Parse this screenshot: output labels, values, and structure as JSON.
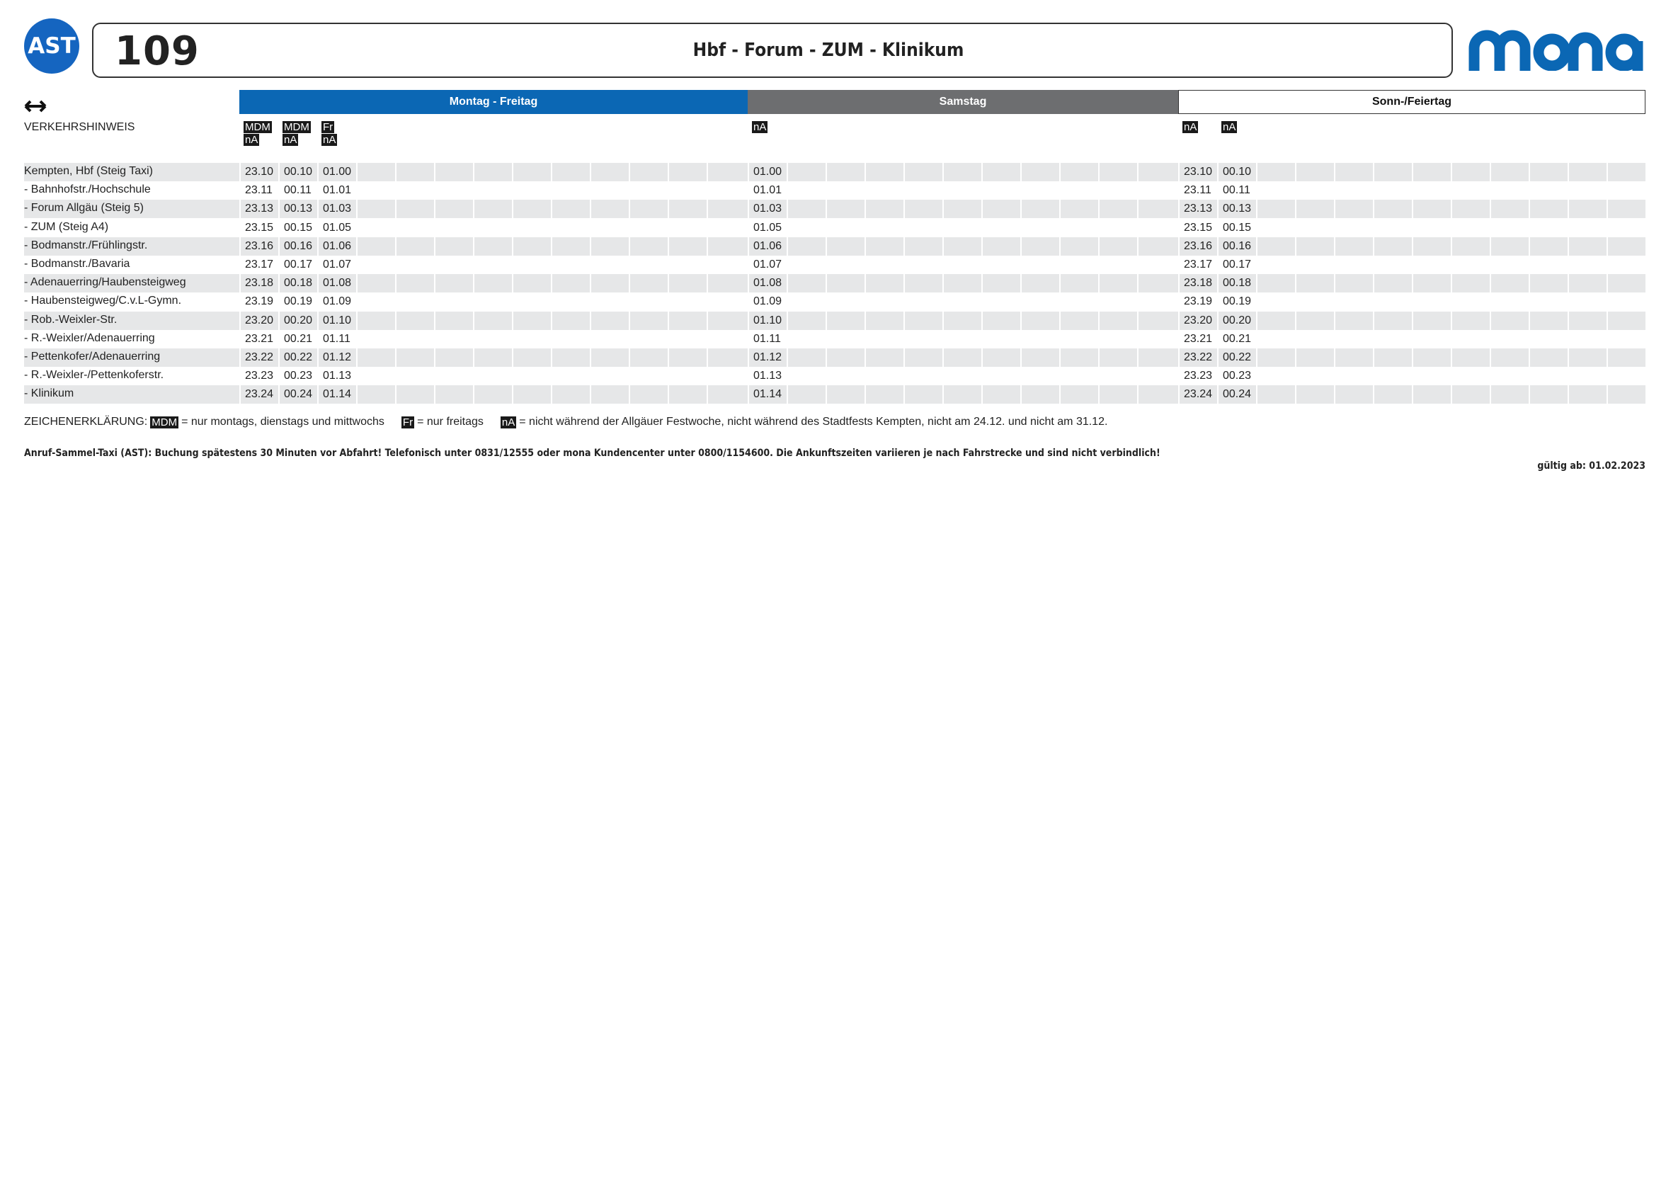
{
  "header": {
    "ast_logo": "AST",
    "line_number": "109",
    "route_title": "Hbf - Forum - ZUM - Klinikum",
    "brand": "mona",
    "brand_color": "#0b67b4"
  },
  "direction_icon": "bidirectional-arrow-icon",
  "days": {
    "weekday": "Montag - Freitag",
    "saturday": "Samstag",
    "sunday": "Sonn-/Feiertag"
  },
  "notes_label": "VERKEHRSHINWEIS",
  "trip_notes": {
    "weekday": [
      [
        "MDM",
        "nA"
      ],
      [
        "MDM",
        "nA"
      ],
      [
        "Fr",
        "nA"
      ]
    ],
    "saturday": [
      [
        "nA"
      ]
    ],
    "sunday": [
      [
        "nA"
      ],
      [
        "nA"
      ]
    ]
  },
  "stops": [
    {
      "name": "Kempten, Hbf (Steig Taxi)",
      "weekday": [
        "23.10",
        "00.10",
        "01.00"
      ],
      "saturday": [
        "01.00"
      ],
      "sunday": [
        "23.10",
        "00.10"
      ]
    },
    {
      "name": "- Bahnhofstr./Hochschule",
      "weekday": [
        "23.11",
        "00.11",
        "01.01"
      ],
      "saturday": [
        "01.01"
      ],
      "sunday": [
        "23.11",
        "00.11"
      ]
    },
    {
      "name": "- Forum Allgäu (Steig 5)",
      "weekday": [
        "23.13",
        "00.13",
        "01.03"
      ],
      "saturday": [
        "01.03"
      ],
      "sunday": [
        "23.13",
        "00.13"
      ]
    },
    {
      "name": "- ZUM (Steig A4)",
      "weekday": [
        "23.15",
        "00.15",
        "01.05"
      ],
      "saturday": [
        "01.05"
      ],
      "sunday": [
        "23.15",
        "00.15"
      ]
    },
    {
      "name": "- Bodmanstr./Frühlingstr.",
      "weekday": [
        "23.16",
        "00.16",
        "01.06"
      ],
      "saturday": [
        "01.06"
      ],
      "sunday": [
        "23.16",
        "00.16"
      ]
    },
    {
      "name": "- Bodmanstr./Bavaria",
      "weekday": [
        "23.17",
        "00.17",
        "01.07"
      ],
      "saturday": [
        "01.07"
      ],
      "sunday": [
        "23.17",
        "00.17"
      ]
    },
    {
      "name": "- Adenauerring/Haubensteigweg",
      "weekday": [
        "23.18",
        "00.18",
        "01.08"
      ],
      "saturday": [
        "01.08"
      ],
      "sunday": [
        "23.18",
        "00.18"
      ]
    },
    {
      "name": "- Haubensteigweg/C.v.L-Gymn.",
      "weekday": [
        "23.19",
        "00.19",
        "01.09"
      ],
      "saturday": [
        "01.09"
      ],
      "sunday": [
        "23.19",
        "00.19"
      ]
    },
    {
      "name": "- Rob.-Weixler-Str.",
      "weekday": [
        "23.20",
        "00.20",
        "01.10"
      ],
      "saturday": [
        "01.10"
      ],
      "sunday": [
        "23.20",
        "00.20"
      ]
    },
    {
      "name": "- R.-Weixler/Adenauerring",
      "weekday": [
        "23.21",
        "00.21",
        "01.11"
      ],
      "saturday": [
        "01.11"
      ],
      "sunday": [
        "23.21",
        "00.21"
      ]
    },
    {
      "name": "- Pettenkofer/Adenauerring",
      "weekday": [
        "23.22",
        "00.22",
        "01.12"
      ],
      "saturday": [
        "01.12"
      ],
      "sunday": [
        "23.22",
        "00.22"
      ]
    },
    {
      "name": "- R.-Weixler-/Pettenkoferstr.",
      "weekday": [
        "23.23",
        "00.23",
        "01.13"
      ],
      "saturday": [
        "01.13"
      ],
      "sunday": [
        "23.23",
        "00.23"
      ]
    },
    {
      "name": "- Klinikum",
      "weekday": [
        "23.24",
        "00.24",
        "01.14"
      ],
      "saturday": [
        "01.14"
      ],
      "sunday": [
        "23.24",
        "00.24"
      ]
    }
  ],
  "legend": {
    "label": "ZEICHENERKLÄRUNG:",
    "items": [
      {
        "tag": "MDM",
        "text": "= nur montags, dienstags und mittwochs"
      },
      {
        "tag": "Fr",
        "text": "= nur freitags"
      },
      {
        "tag": "nA",
        "text": "= nicht während der Allgäuer Festwoche, nicht während des Stadtfests Kempten, nicht am 24.12. und nicht am 31.12."
      }
    ]
  },
  "footnote": "Anruf-Sammel-Taxi (AST): Buchung spätestens 30 Minuten vor Abfahrt! Telefonisch unter 0831/12555 oder mona Kundencenter unter 0800/1154600. Die Ankunftszeiten variieren je nach Fahrstrecke und sind nicht verbindlich!",
  "valid_from": "gültig ab: 01.02.2023"
}
